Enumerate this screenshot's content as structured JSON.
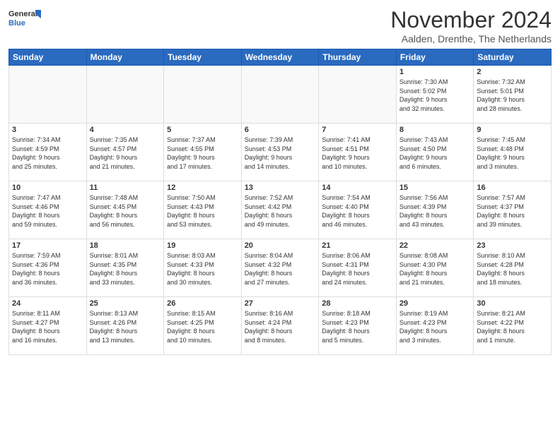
{
  "logo": {
    "general": "General",
    "blue": "Blue"
  },
  "title": "November 2024",
  "subtitle": "Aalden, Drenthe, The Netherlands",
  "headers": [
    "Sunday",
    "Monday",
    "Tuesday",
    "Wednesday",
    "Thursday",
    "Friday",
    "Saturday"
  ],
  "weeks": [
    [
      {
        "day": "",
        "info": ""
      },
      {
        "day": "",
        "info": ""
      },
      {
        "day": "",
        "info": ""
      },
      {
        "day": "",
        "info": ""
      },
      {
        "day": "",
        "info": ""
      },
      {
        "day": "1",
        "info": "Sunrise: 7:30 AM\nSunset: 5:02 PM\nDaylight: 9 hours\nand 32 minutes."
      },
      {
        "day": "2",
        "info": "Sunrise: 7:32 AM\nSunset: 5:01 PM\nDaylight: 9 hours\nand 28 minutes."
      }
    ],
    [
      {
        "day": "3",
        "info": "Sunrise: 7:34 AM\nSunset: 4:59 PM\nDaylight: 9 hours\nand 25 minutes."
      },
      {
        "day": "4",
        "info": "Sunrise: 7:35 AM\nSunset: 4:57 PM\nDaylight: 9 hours\nand 21 minutes."
      },
      {
        "day": "5",
        "info": "Sunrise: 7:37 AM\nSunset: 4:55 PM\nDaylight: 9 hours\nand 17 minutes."
      },
      {
        "day": "6",
        "info": "Sunrise: 7:39 AM\nSunset: 4:53 PM\nDaylight: 9 hours\nand 14 minutes."
      },
      {
        "day": "7",
        "info": "Sunrise: 7:41 AM\nSunset: 4:51 PM\nDaylight: 9 hours\nand 10 minutes."
      },
      {
        "day": "8",
        "info": "Sunrise: 7:43 AM\nSunset: 4:50 PM\nDaylight: 9 hours\nand 6 minutes."
      },
      {
        "day": "9",
        "info": "Sunrise: 7:45 AM\nSunset: 4:48 PM\nDaylight: 9 hours\nand 3 minutes."
      }
    ],
    [
      {
        "day": "10",
        "info": "Sunrise: 7:47 AM\nSunset: 4:46 PM\nDaylight: 8 hours\nand 59 minutes."
      },
      {
        "day": "11",
        "info": "Sunrise: 7:48 AM\nSunset: 4:45 PM\nDaylight: 8 hours\nand 56 minutes."
      },
      {
        "day": "12",
        "info": "Sunrise: 7:50 AM\nSunset: 4:43 PM\nDaylight: 8 hours\nand 53 minutes."
      },
      {
        "day": "13",
        "info": "Sunrise: 7:52 AM\nSunset: 4:42 PM\nDaylight: 8 hours\nand 49 minutes."
      },
      {
        "day": "14",
        "info": "Sunrise: 7:54 AM\nSunset: 4:40 PM\nDaylight: 8 hours\nand 46 minutes."
      },
      {
        "day": "15",
        "info": "Sunrise: 7:56 AM\nSunset: 4:39 PM\nDaylight: 8 hours\nand 43 minutes."
      },
      {
        "day": "16",
        "info": "Sunrise: 7:57 AM\nSunset: 4:37 PM\nDaylight: 8 hours\nand 39 minutes."
      }
    ],
    [
      {
        "day": "17",
        "info": "Sunrise: 7:59 AM\nSunset: 4:36 PM\nDaylight: 8 hours\nand 36 minutes."
      },
      {
        "day": "18",
        "info": "Sunrise: 8:01 AM\nSunset: 4:35 PM\nDaylight: 8 hours\nand 33 minutes."
      },
      {
        "day": "19",
        "info": "Sunrise: 8:03 AM\nSunset: 4:33 PM\nDaylight: 8 hours\nand 30 minutes."
      },
      {
        "day": "20",
        "info": "Sunrise: 8:04 AM\nSunset: 4:32 PM\nDaylight: 8 hours\nand 27 minutes."
      },
      {
        "day": "21",
        "info": "Sunrise: 8:06 AM\nSunset: 4:31 PM\nDaylight: 8 hours\nand 24 minutes."
      },
      {
        "day": "22",
        "info": "Sunrise: 8:08 AM\nSunset: 4:30 PM\nDaylight: 8 hours\nand 21 minutes."
      },
      {
        "day": "23",
        "info": "Sunrise: 8:10 AM\nSunset: 4:28 PM\nDaylight: 8 hours\nand 18 minutes."
      }
    ],
    [
      {
        "day": "24",
        "info": "Sunrise: 8:11 AM\nSunset: 4:27 PM\nDaylight: 8 hours\nand 16 minutes."
      },
      {
        "day": "25",
        "info": "Sunrise: 8:13 AM\nSunset: 4:26 PM\nDaylight: 8 hours\nand 13 minutes."
      },
      {
        "day": "26",
        "info": "Sunrise: 8:15 AM\nSunset: 4:25 PM\nDaylight: 8 hours\nand 10 minutes."
      },
      {
        "day": "27",
        "info": "Sunrise: 8:16 AM\nSunset: 4:24 PM\nDaylight: 8 hours\nand 8 minutes."
      },
      {
        "day": "28",
        "info": "Sunrise: 8:18 AM\nSunset: 4:23 PM\nDaylight: 8 hours\nand 5 minutes."
      },
      {
        "day": "29",
        "info": "Sunrise: 8:19 AM\nSunset: 4:23 PM\nDaylight: 8 hours\nand 3 minutes."
      },
      {
        "day": "30",
        "info": "Sunrise: 8:21 AM\nSunset: 4:22 PM\nDaylight: 8 hours\nand 1 minute."
      }
    ]
  ]
}
